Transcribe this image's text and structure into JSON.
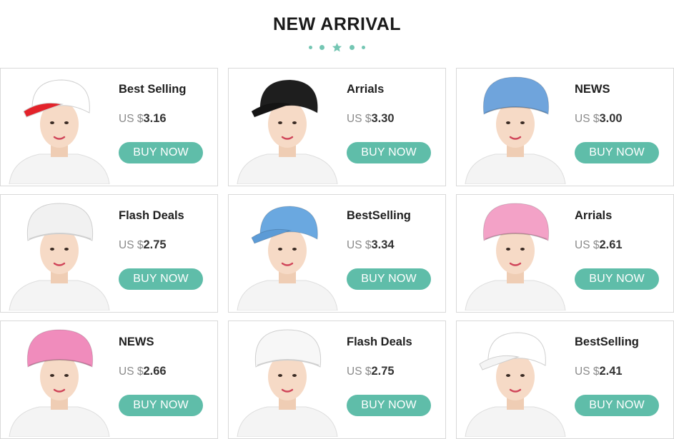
{
  "header": {
    "title": "NEW ARRIVAL"
  },
  "theme": {
    "accent": "#5fbda9"
  },
  "products": [
    {
      "name": "Best Selling",
      "currency": "US $",
      "price": "3.16",
      "button": "BUY NOW",
      "hat_color": "#ffffff",
      "visor_color": "#e3222a",
      "style": "visor"
    },
    {
      "name": "Arrials",
      "currency": "US $",
      "price": "3.30",
      "button": "BUY NOW",
      "hat_color": "#1e1e1e",
      "visor_color": "#141414",
      "style": "visor"
    },
    {
      "name": "NEWS",
      "currency": "US $",
      "price": "3.00",
      "button": "BUY NOW",
      "hat_color": "#6fa4dc",
      "visor_color": "",
      "style": "bouffant"
    },
    {
      "name": "Flash Deals",
      "currency": "US $",
      "price": "2.75",
      "button": "BUY NOW",
      "hat_color": "#f1f1f1",
      "visor_color": "",
      "style": "bouffant"
    },
    {
      "name": "BestSelling",
      "currency": "US $",
      "price": "3.34",
      "button": "BUY NOW",
      "hat_color": "#6aa8e0",
      "visor_color": "#5c9bd6",
      "style": "visor"
    },
    {
      "name": "Arrials",
      "currency": "US $",
      "price": "2.61",
      "button": "BUY NOW",
      "hat_color": "#f3a2c7",
      "visor_color": "",
      "style": "bouffant"
    },
    {
      "name": "NEWS",
      "currency": "US $",
      "price": "2.66",
      "button": "BUY NOW",
      "hat_color": "#f08cbc",
      "visor_color": "",
      "style": "bouffant"
    },
    {
      "name": "Flash Deals",
      "currency": "US $",
      "price": "2.75",
      "button": "BUY NOW",
      "hat_color": "#f7f7f7",
      "visor_color": "",
      "style": "bouffant"
    },
    {
      "name": "BestSelling",
      "currency": "US $",
      "price": "2.41",
      "button": "BUY NOW",
      "hat_color": "#ffffff",
      "visor_color": "#f4f4f4",
      "style": "visor"
    }
  ]
}
